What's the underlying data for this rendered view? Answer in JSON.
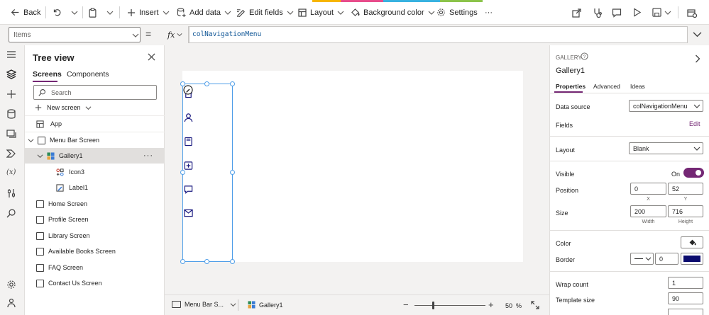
{
  "toolbar": {
    "back": "Back",
    "insert": "Insert",
    "add_data": "Add data",
    "edit_fields": "Edit fields",
    "layout": "Layout",
    "background_color": "Background color",
    "settings": "Settings",
    "more": "···"
  },
  "formula_bar": {
    "property": "Items",
    "equals": "=",
    "fx": "fx",
    "formula": "colNavigationMenu"
  },
  "tree": {
    "title": "Tree view",
    "tabs": [
      "Screens",
      "Components"
    ],
    "search_placeholder": "Search",
    "new_screen": "New screen",
    "items": [
      "App",
      "Menu Bar Screen",
      "Gallery1",
      "Icon3",
      "Label1",
      "Home Screen",
      "Profile Screen",
      "Library Screen",
      "Available Books Screen",
      "FAQ Screen",
      "Contact Us Screen"
    ],
    "more": "···"
  },
  "status_bar": {
    "screen": "Menu Bar S...",
    "control": "Gallery1",
    "zoom": "50",
    "zoom_unit": "%",
    "zoom_fraction": 0.5
  },
  "panel": {
    "type_label": "GALLERY",
    "name": "Gallery1",
    "tabs": [
      "Properties",
      "Advanced",
      "Ideas"
    ],
    "data_source_label": "Data source",
    "data_source": "colNavigationMenu",
    "fields_label": "Fields",
    "fields_edit": "Edit",
    "layout_label": "Layout",
    "layout_value": "Blank",
    "visible_label": "Visible",
    "visible_value": "On",
    "position_label": "Position",
    "position_x": "0",
    "position_y": "52",
    "x_label": "X",
    "y_label": "Y",
    "size_label": "Size",
    "width": "200",
    "height": "716",
    "width_label": "Width",
    "height_label": "Height",
    "color_label": "Color",
    "border_label": "Border",
    "border_width": "0",
    "border_color": "#0b0b6e",
    "wrap_count_label": "Wrap count",
    "wrap_count": "1",
    "template_size_label": "Template size",
    "template_size": "90"
  },
  "colors": {
    "accent": "#742774",
    "toggle_on": "#742774",
    "selection": "#4f9ee8",
    "icon_navy": "#1b1b80"
  }
}
